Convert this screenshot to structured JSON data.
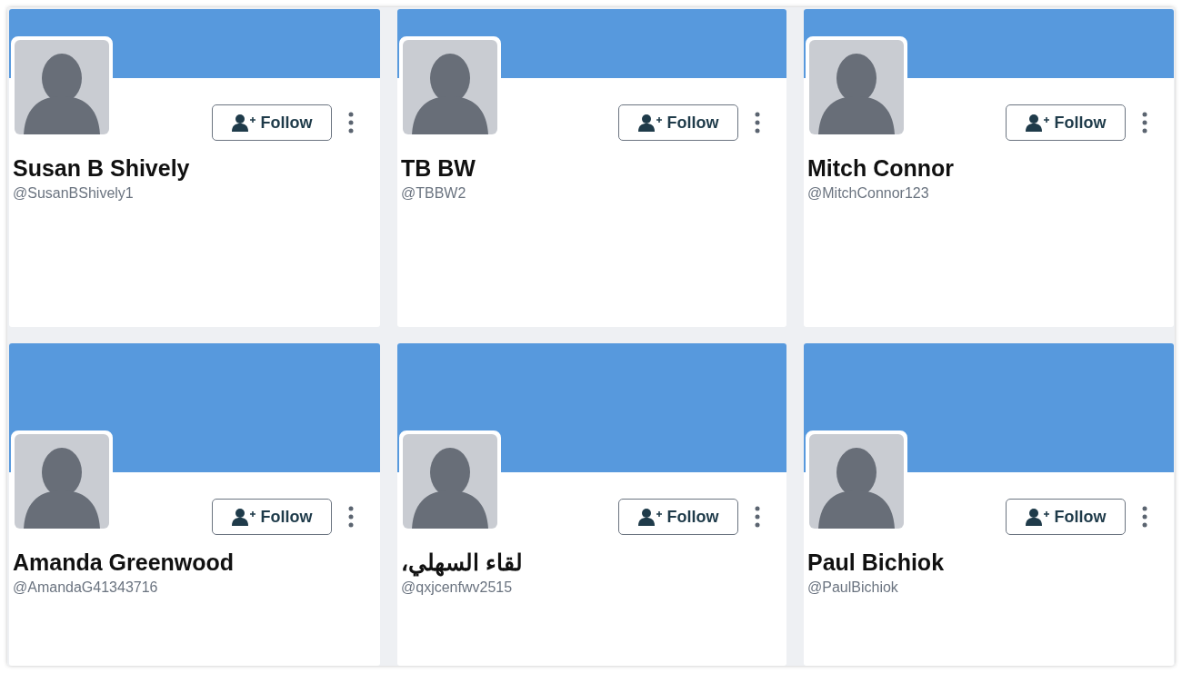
{
  "profiles": [
    {
      "name": "Susan B Shively",
      "handle": "@SusanBShively1",
      "follow_label": "Follow"
    },
    {
      "name": "TB BW",
      "handle": "@TBBW2",
      "follow_label": "Follow"
    },
    {
      "name": "Mitch Connor",
      "handle": "@MitchConnor123",
      "follow_label": "Follow"
    },
    {
      "name": "Amanda Greenwood",
      "handle": "@AmandaG41343716",
      "follow_label": "Follow"
    },
    {
      "name": "لقاء السهلي،",
      "handle": "@qxjcenfwv2515",
      "follow_label": "Follow"
    },
    {
      "name": "Paul Bichiok",
      "handle": "@PaulBichiok",
      "follow_label": "Follow"
    }
  ]
}
